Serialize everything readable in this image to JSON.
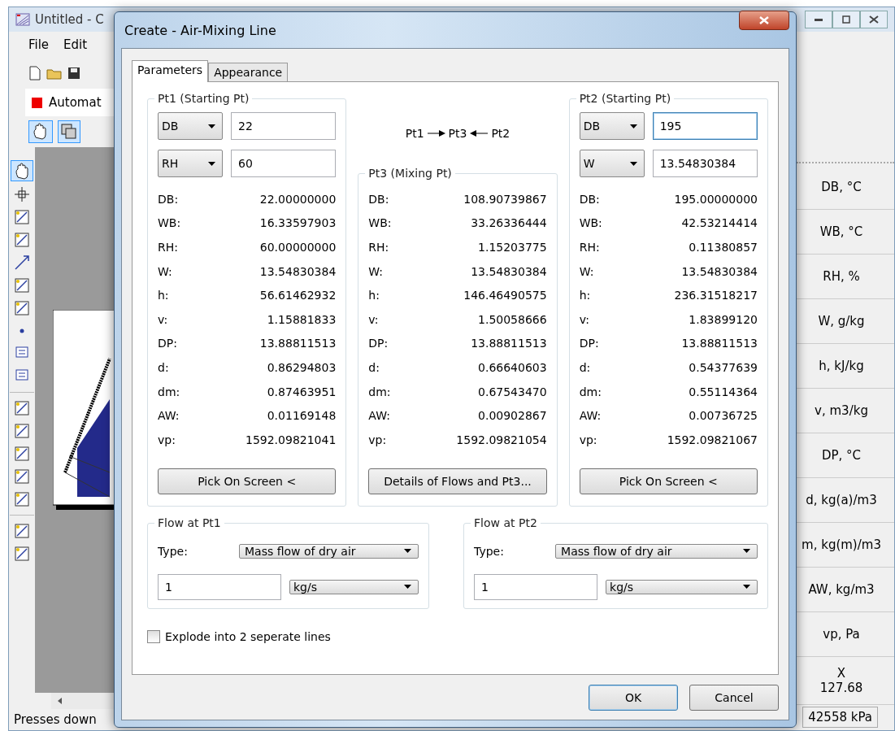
{
  "app": {
    "title": "Untitled - C",
    "menu": [
      "File",
      "Edit"
    ],
    "style_combo": "Automat",
    "status": "Presses down",
    "side_columns": [
      "DB, °C",
      "WB, °C",
      "RH, %",
      "W, g/kg",
      "h, kJ/kg",
      "v, m3/kg",
      "DP, °C",
      "d, kg(a)/m3",
      "m, kg(m)/m3",
      "AW, kg/m3",
      "vp, Pa"
    ],
    "cursor_label": "X",
    "cursor_value": "127.68",
    "pressure": "42558 kPa"
  },
  "dialog": {
    "title": "Create - Air-Mixing Line",
    "tabs": [
      {
        "label": "Parameters",
        "selected": true
      },
      {
        "label": "Appearance",
        "selected": false
      }
    ],
    "diagram": [
      "Pt1",
      "Pt3",
      "Pt2"
    ],
    "points": [
      {
        "kind": "input",
        "title": "Pt1 (Starting Pt)",
        "inputs": [
          {
            "property": "DB",
            "value": "22",
            "focused": false
          },
          {
            "property": "RH",
            "value": "60",
            "focused": false
          }
        ],
        "rows": [
          [
            "DB:",
            "22.00000000"
          ],
          [
            "WB:",
            "16.33597903"
          ],
          [
            "RH:",
            "60.00000000"
          ],
          [
            "W:",
            "13.54830384"
          ],
          [
            "h:",
            "56.61462932"
          ],
          [
            "v:",
            "1.15881833"
          ],
          [
            "DP:",
            "13.88811513"
          ],
          [
            "d:",
            "0.86294803"
          ],
          [
            "dm:",
            "0.87463951"
          ],
          [
            "AW:",
            "0.01169148"
          ],
          [
            "vp:",
            "1592.09821041"
          ]
        ],
        "button": "Pick On Screen <"
      },
      {
        "kind": "result",
        "title": "Pt3 (Mixing Pt)",
        "rows": [
          [
            "DB:",
            "108.90739867"
          ],
          [
            "WB:",
            "33.26336444"
          ],
          [
            "RH:",
            "1.15203775"
          ],
          [
            "W:",
            "13.54830384"
          ],
          [
            "h:",
            "146.46490575"
          ],
          [
            "v:",
            "1.50058666"
          ],
          [
            "DP:",
            "13.88811513"
          ],
          [
            "d:",
            "0.66640603"
          ],
          [
            "dm:",
            "0.67543470"
          ],
          [
            "AW:",
            "0.00902867"
          ],
          [
            "vp:",
            "1592.09821054"
          ]
        ],
        "button": "Details of Flows and Pt3..."
      },
      {
        "kind": "input",
        "title": "Pt2 (Starting Pt)",
        "inputs": [
          {
            "property": "DB",
            "value": "195",
            "focused": true
          },
          {
            "property": "W",
            "value": "13.54830384",
            "focused": false
          }
        ],
        "rows": [
          [
            "DB:",
            "195.00000000"
          ],
          [
            "WB:",
            "42.53214414"
          ],
          [
            "RH:",
            "0.11380857"
          ],
          [
            "W:",
            "13.54830384"
          ],
          [
            "h:",
            "236.31518217"
          ],
          [
            "v:",
            "1.83899120"
          ],
          [
            "DP:",
            "13.88811513"
          ],
          [
            "d:",
            "0.54377639"
          ],
          [
            "dm:",
            "0.55114364"
          ],
          [
            "AW:",
            "0.00736725"
          ],
          [
            "vp:",
            "1592.09821067"
          ]
        ],
        "button": "Pick On Screen <"
      }
    ],
    "flows": [
      {
        "title": "Flow at Pt1",
        "type_label": "Type:",
        "type": "Mass flow of dry air",
        "value": "1",
        "unit": "kg/s"
      },
      {
        "title": "Flow at Pt2",
        "type_label": "Type:",
        "type": "Mass flow of dry air",
        "value": "1",
        "unit": "kg/s"
      }
    ],
    "explode": {
      "label": "Explode into 2 seperate lines",
      "checked": false
    },
    "buttons": [
      "OK",
      "Cancel"
    ]
  }
}
